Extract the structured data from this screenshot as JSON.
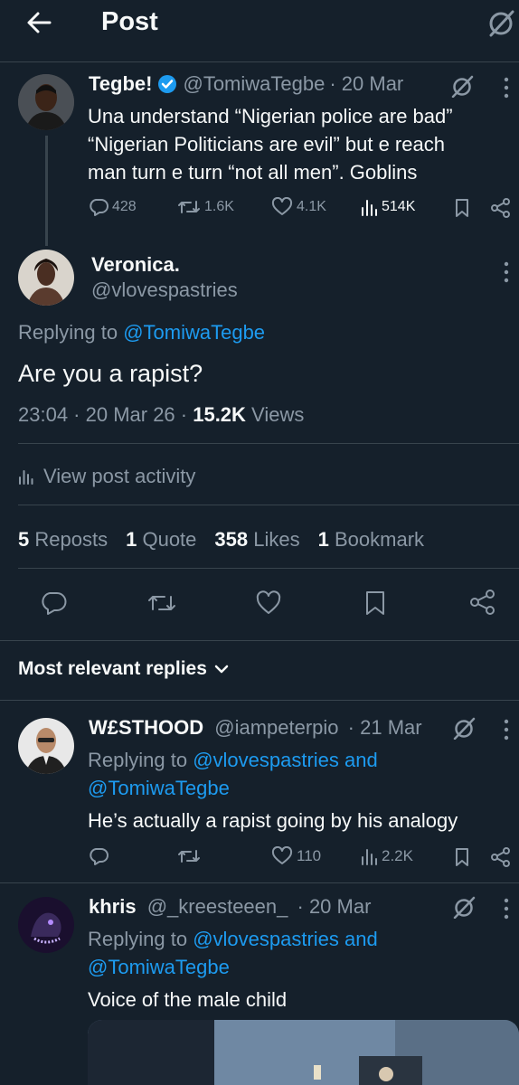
{
  "header": {
    "title": "Post"
  },
  "parent_post": {
    "display_name": "Tegbe!",
    "handle": "@TomiwaTegbe",
    "date": "· 20 Mar",
    "text_lines": [
      "Una understand “Nigerian police are bad”",
      "“Nigerian Politicians are evil” but e reach",
      "man turn e turn “not all men”. Goblins"
    ],
    "replies": "428",
    "reposts": "1.6K",
    "likes": "4.1K",
    "views": "514K"
  },
  "main_post": {
    "display_name": "Veronica.",
    "handle": "@vlovespastries",
    "replying_prefix": "Replying to ",
    "replying_to": "@TomiwaTegbe",
    "text": "Are you a rapist?",
    "time": "23:04 · 20 Mar 26 · ",
    "views_count": "15.2K",
    "views_label": " Views",
    "view_activity": "View post activity",
    "reposts_count": "5",
    "reposts_label": "Reposts",
    "quotes_count": "1",
    "quotes_label": "Quote",
    "likes_count": "358",
    "likes_label": "Likes",
    "bookmarks_count": "1",
    "bookmarks_label": "Bookmark"
  },
  "replies_section": {
    "title": "Most relevant replies"
  },
  "reply1": {
    "display_name": "W£STHOOD",
    "handle": "@iampeterpio",
    "date": "· 21 Mar",
    "replying_prefix": "Replying to ",
    "replying_to_1": "@vlovespastries",
    "replying_and": " and",
    "replying_to_2": "@TomiwaTegbe",
    "text": "He’s actually a rapist going by his analogy",
    "likes": "110",
    "views": "2.2K"
  },
  "reply2": {
    "display_name": "khris",
    "handle": "@_kreesteeen_",
    "date": "· 20 Mar",
    "replying_prefix": "Replying to ",
    "replying_to_1": "@vlovespastries",
    "replying_and": " and",
    "replying_to_2": "@TomiwaTegbe",
    "text": "Voice of the male child"
  },
  "colors": {
    "background": "#15202b",
    "text": "#f7f9f9",
    "muted": "#8b98a5",
    "link": "#1d9bf0",
    "divider": "#38444d"
  }
}
